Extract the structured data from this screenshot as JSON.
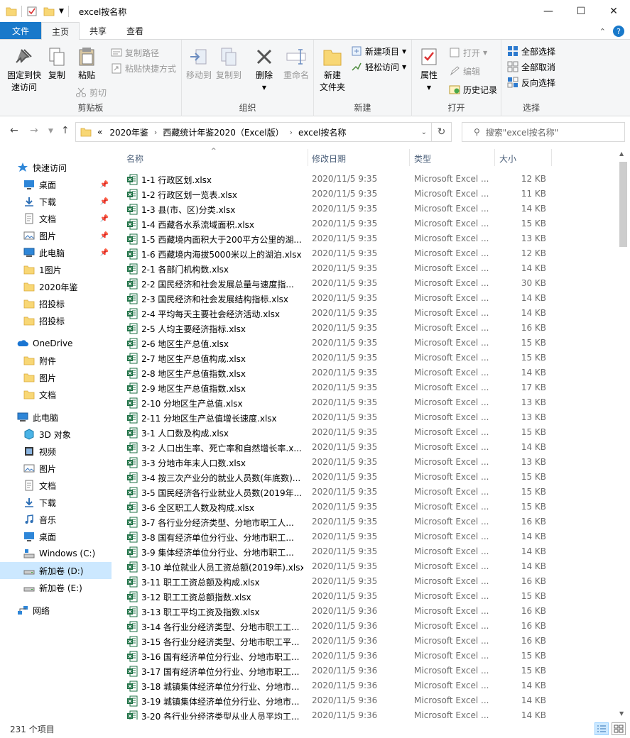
{
  "window": {
    "title": "excel按名称",
    "minimize": "—",
    "maximize": "☐",
    "close": "✕"
  },
  "ribbon_tabs": [
    "文件",
    "主页",
    "共享",
    "查看"
  ],
  "ribbon": {
    "clipboard": {
      "label": "剪贴板",
      "pin": "固定到快\n速访问",
      "copy": "复制",
      "paste": "粘贴",
      "copy_path": "复制路径",
      "paste_shortcut": "粘贴快捷方式",
      "cut": "剪切"
    },
    "organize": {
      "label": "组织",
      "move_to": "移动到",
      "copy_to": "复制到",
      "delete": "删除",
      "rename": "重命名"
    },
    "new": {
      "label": "新建",
      "new_folder": "新建\n文件夹",
      "new_item": "新建项目",
      "easy_access": "轻松访问"
    },
    "open": {
      "label": "打开",
      "properties": "属性",
      "open": "打开",
      "edit": "编辑",
      "history": "历史记录"
    },
    "select": {
      "label": "选择",
      "select_all": "全部选择",
      "select_none": "全部取消",
      "invert": "反向选择"
    }
  },
  "address": {
    "overflow": "«",
    "crumbs": [
      "2020年鉴",
      "西藏统计年鉴2020（Excel版）",
      "excel按名称"
    ],
    "search_placeholder": "搜索\"excel按名称\""
  },
  "sidebar": {
    "quick_access": "快速访问",
    "quick_items": [
      {
        "label": "桌面",
        "icon": "desktop-icon",
        "pinned": true
      },
      {
        "label": "下载",
        "icon": "download-icon",
        "pinned": true
      },
      {
        "label": "文档",
        "icon": "document-icon",
        "pinned": true
      },
      {
        "label": "图片",
        "icon": "pictures-icon",
        "pinned": true
      },
      {
        "label": "此电脑",
        "icon": "computer-icon",
        "pinned": true
      },
      {
        "label": "1图片",
        "icon": "folder-icon",
        "pinned": false
      },
      {
        "label": "2020年鉴",
        "icon": "folder-icon",
        "pinned": false
      },
      {
        "label": "招投标",
        "icon": "folder-icon",
        "pinned": false
      },
      {
        "label": "招投标",
        "icon": "folder-icon",
        "pinned": false
      }
    ],
    "onedrive": "OneDrive",
    "onedrive_items": [
      "附件",
      "图片",
      "文档"
    ],
    "this_pc": "此电脑",
    "pc_items": [
      {
        "label": "3D 对象",
        "icon": "3d-objects-icon"
      },
      {
        "label": "视频",
        "icon": "video-icon"
      },
      {
        "label": "图片",
        "icon": "pictures-icon"
      },
      {
        "label": "文档",
        "icon": "document-icon"
      },
      {
        "label": "下载",
        "icon": "download-icon"
      },
      {
        "label": "音乐",
        "icon": "music-icon"
      },
      {
        "label": "桌面",
        "icon": "desktop-icon"
      },
      {
        "label": "Windows (C:)",
        "icon": "drive-c-icon"
      },
      {
        "label": "新加卷 (D:)",
        "icon": "drive-icon"
      },
      {
        "label": "新加卷 (E:)",
        "icon": "drive-icon"
      }
    ],
    "network": "网络"
  },
  "columns": {
    "name": "名称",
    "date": "修改日期",
    "type": "类型",
    "size": "大小"
  },
  "files": [
    {
      "name": "1-1  行政区划.xlsx",
      "date": "2020/11/5 9:35",
      "type": "Microsoft Excel ...",
      "size": "12 KB"
    },
    {
      "name": "1-2  行政区划一览表.xlsx",
      "date": "2020/11/5 9:35",
      "type": "Microsoft Excel ...",
      "size": "11 KB"
    },
    {
      "name": "1-3  县(市、区)分类.xlsx",
      "date": "2020/11/5 9:35",
      "type": "Microsoft Excel ...",
      "size": "14 KB"
    },
    {
      "name": "1-4  西藏各水系流域面积.xlsx",
      "date": "2020/11/5 9:35",
      "type": "Microsoft Excel ...",
      "size": "15 KB"
    },
    {
      "name": "1-5  西藏境内面积大于200平方公里的湖...",
      "date": "2020/11/5 9:35",
      "type": "Microsoft Excel ...",
      "size": "13 KB"
    },
    {
      "name": "1-6  西藏境内海拔5000米以上的湖泊.xlsx",
      "date": "2020/11/5 9:35",
      "type": "Microsoft Excel ...",
      "size": "12 KB"
    },
    {
      "name": "2-1  各部门机构数.xlsx",
      "date": "2020/11/5 9:35",
      "type": "Microsoft Excel ...",
      "size": "14 KB"
    },
    {
      "name": "2-2  国民经济和社会发展总量与速度指...",
      "date": "2020/11/5 9:35",
      "type": "Microsoft Excel ...",
      "size": "30 KB"
    },
    {
      "name": "2-3  国民经济和社会发展结构指标.xlsx",
      "date": "2020/11/5 9:35",
      "type": "Microsoft Excel ...",
      "size": "14 KB"
    },
    {
      "name": "2-4  平均每天主要社会经济活动.xlsx",
      "date": "2020/11/5 9:35",
      "type": "Microsoft Excel ...",
      "size": "14 KB"
    },
    {
      "name": "2-5  人均主要经济指标.xlsx",
      "date": "2020/11/5 9:35",
      "type": "Microsoft Excel ...",
      "size": "16 KB"
    },
    {
      "name": "2-6  地区生产总值.xlsx",
      "date": "2020/11/5 9:35",
      "type": "Microsoft Excel ...",
      "size": "15 KB"
    },
    {
      "name": "2-7  地区生产总值构成.xlsx",
      "date": "2020/11/5 9:35",
      "type": "Microsoft Excel ...",
      "size": "15 KB"
    },
    {
      "name": "2-8  地区生产总值指数.xlsx",
      "date": "2020/11/5 9:35",
      "type": "Microsoft Excel ...",
      "size": "14 KB"
    },
    {
      "name": "2-9  地区生产总值指数.xlsx",
      "date": "2020/11/5 9:35",
      "type": "Microsoft Excel ...",
      "size": "17 KB"
    },
    {
      "name": "2-10  分地区生产总值.xlsx",
      "date": "2020/11/5 9:35",
      "type": "Microsoft Excel ...",
      "size": "13 KB"
    },
    {
      "name": "2-11  分地区生产总值增长速度.xlsx",
      "date": "2020/11/5 9:35",
      "type": "Microsoft Excel ...",
      "size": "13 KB"
    },
    {
      "name": "3-1  人口数及构成.xlsx",
      "date": "2020/11/5 9:35",
      "type": "Microsoft Excel ...",
      "size": "15 KB"
    },
    {
      "name": "3-2  人口出生率、死亡率和自然增长率.x...",
      "date": "2020/11/5 9:35",
      "type": "Microsoft Excel ...",
      "size": "14 KB"
    },
    {
      "name": "3-3  分地市年末人口数.xlsx",
      "date": "2020/11/5 9:35",
      "type": "Microsoft Excel ...",
      "size": "13 KB"
    },
    {
      "name": "3-4  按三次产业分的就业人员数(年底数)...",
      "date": "2020/11/5 9:35",
      "type": "Microsoft Excel ...",
      "size": "15 KB"
    },
    {
      "name": "3-5  国民经济各行业就业人员数(2019年...",
      "date": "2020/11/5 9:35",
      "type": "Microsoft Excel ...",
      "size": "15 KB"
    },
    {
      "name": "3-6  全区职工人数及构成.xlsx",
      "date": "2020/11/5 9:35",
      "type": "Microsoft Excel ...",
      "size": "15 KB"
    },
    {
      "name": "3-7  各行业分经济类型、分地市职工人...",
      "date": "2020/11/5 9:35",
      "type": "Microsoft Excel ...",
      "size": "16 KB"
    },
    {
      "name": "3-8  国有经济单位分行业、分地市职工...",
      "date": "2020/11/5 9:35",
      "type": "Microsoft Excel ...",
      "size": "14 KB"
    },
    {
      "name": "3-9  集体经济单位分行业、分地市职工...",
      "date": "2020/11/5 9:35",
      "type": "Microsoft Excel ...",
      "size": "14 KB"
    },
    {
      "name": "3-10  单位就业人员工资总额(2019年).xlsx",
      "date": "2020/11/5 9:35",
      "type": "Microsoft Excel ...",
      "size": "14 KB"
    },
    {
      "name": "3-11  职工工资总额及构成.xlsx",
      "date": "2020/11/5 9:35",
      "type": "Microsoft Excel ...",
      "size": "16 KB"
    },
    {
      "name": "3-12  职工工资总额指数.xlsx",
      "date": "2020/11/5 9:35",
      "type": "Microsoft Excel ...",
      "size": "15 KB"
    },
    {
      "name": "3-13  职工平均工资及指数.xlsx",
      "date": "2020/11/5 9:36",
      "type": "Microsoft Excel ...",
      "size": "16 KB"
    },
    {
      "name": "3-14  各行业分经济类型、分地市职工工...",
      "date": "2020/11/5 9:36",
      "type": "Microsoft Excel ...",
      "size": "16 KB"
    },
    {
      "name": "3-15  各行业分经济类型、分地市职工平...",
      "date": "2020/11/5 9:36",
      "type": "Microsoft Excel ...",
      "size": "16 KB"
    },
    {
      "name": "3-16  国有经济单位分行业、分地市职工...",
      "date": "2020/11/5 9:36",
      "type": "Microsoft Excel ...",
      "size": "15 KB"
    },
    {
      "name": "3-17  国有经济单位分行业、分地市职工...",
      "date": "2020/11/5 9:36",
      "type": "Microsoft Excel ...",
      "size": "15 KB"
    },
    {
      "name": "3-18  城镇集体经济单位分行业、分地市...",
      "date": "2020/11/5 9:36",
      "type": "Microsoft Excel ...",
      "size": "14 KB"
    },
    {
      "name": "3-19  城镇集体经济单位分行业、分地市...",
      "date": "2020/11/5 9:36",
      "type": "Microsoft Excel ...",
      "size": "14 KB"
    },
    {
      "name": "3-20  各行业分经济类型从业人员平均工...",
      "date": "2020/11/5 9:36",
      "type": "Microsoft Excel ...",
      "size": "14 KB"
    }
  ],
  "status": {
    "count": "231 个项目"
  },
  "colors": {
    "accent": "#1979ca",
    "selected": "#cce8ff",
    "excel_green": "#1e7145",
    "folder": "#f8d775"
  }
}
